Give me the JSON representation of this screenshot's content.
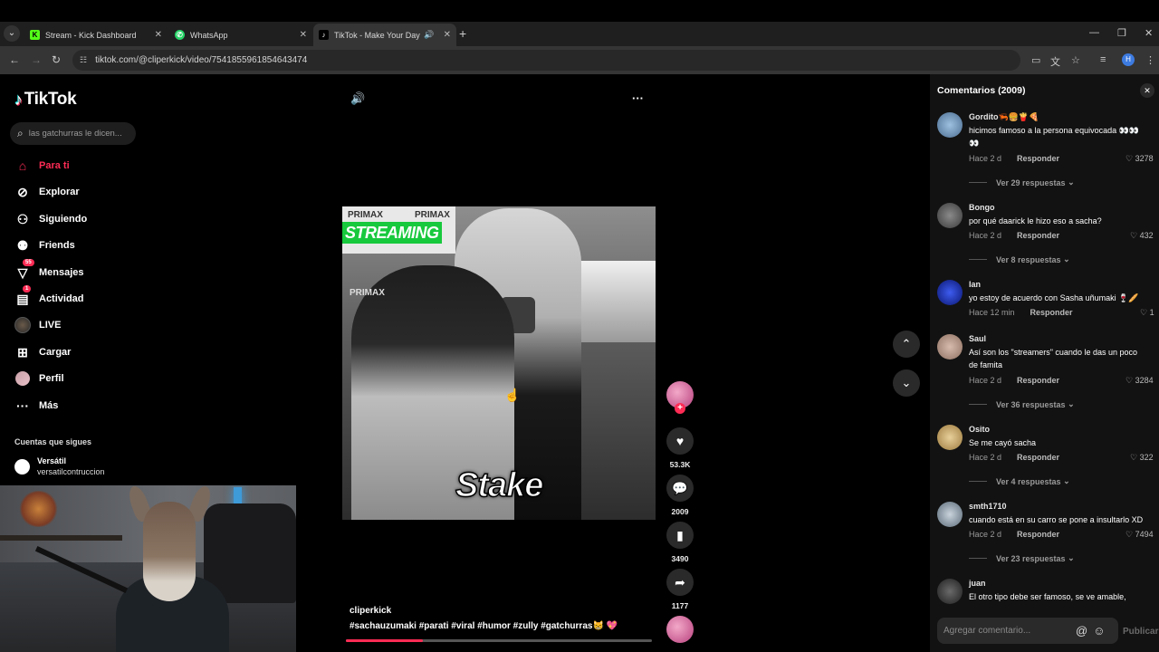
{
  "browser": {
    "tabs": [
      {
        "title": "Stream - Kick Dashboard",
        "favicon_color": "#53fc18",
        "favicon_glyph": "K"
      },
      {
        "title": "WhatsApp",
        "favicon_color": "#25d366",
        "favicon_glyph": "✆"
      },
      {
        "title": "TikTok - Make Your Day",
        "favicon_color": "#000000",
        "favicon_glyph": "♪"
      }
    ],
    "url": "tiktok.com/@cliperkick/video/7541855961854643474",
    "profile_initial": "H"
  },
  "sidebar": {
    "logo": "TikTok",
    "search_placeholder": "las gatchurras le dicen...",
    "nav": [
      {
        "label": "Para ti",
        "icon": "home-icon",
        "active": true
      },
      {
        "label": "Explorar",
        "icon": "compass-icon"
      },
      {
        "label": "Siguiendo",
        "icon": "following-icon"
      },
      {
        "label": "Friends",
        "icon": "friends-icon"
      },
      {
        "label": "Mensajes",
        "icon": "messages-icon",
        "badge": "55"
      },
      {
        "label": "Actividad",
        "icon": "activity-icon",
        "badge": "1"
      },
      {
        "label": "LIVE",
        "icon": "live-icon"
      },
      {
        "label": "Cargar",
        "icon": "upload-icon"
      },
      {
        "label": "Perfil",
        "icon": "profile-icon"
      },
      {
        "label": "Más",
        "icon": "more-icon"
      }
    ],
    "follows_title": "Cuentas que sigues",
    "followed_account": {
      "name": "Versátil",
      "handle": "versatilcontruccion"
    }
  },
  "video": {
    "overlay_text_streaming": "STREAMING",
    "overlay_brand": "PRIMAX",
    "overlay_stake": "Stake",
    "author": "cliperkick",
    "hashtags": "#sachauzumaki #parati #viral #humor #zully #gatchurras😸 💖",
    "progress_fraction": 0.25
  },
  "actions": {
    "likes": "53.3K",
    "comments": "2009",
    "saves": "3490",
    "shares": "1177"
  },
  "comments_panel": {
    "title": "Comentarios (2009)",
    "input_placeholder": "Agregar comentario...",
    "publish_label": "Publicar",
    "reply_label": "Responder",
    "comments": [
      {
        "user": "Gordito🦐🍔🍟🍕",
        "text": "hicimos famoso a la persona equivocada 👀👀👀",
        "time": "Hace 2 d",
        "likes": "3278",
        "replies": "Ver 29 respuestas",
        "avatar_color": "#6a8caf"
      },
      {
        "user": "Bongo",
        "text": "por qué daarick le hizo eso a sacha?",
        "time": "Hace 2 d",
        "likes": "432",
        "replies": "Ver 8 respuestas",
        "avatar_color": "#5a5a5a"
      },
      {
        "user": "Ian",
        "text": "yo estoy de acuerdo con Sasha uñumaki 🍷🥖",
        "time": "Hace 12 min",
        "likes": "1",
        "replies": "",
        "avatar_color": "#1c2fa8"
      },
      {
        "user": "Saul",
        "text": "Así son los \"streamers\" cuando le das un poco de famita",
        "time": "Hace 2 d",
        "likes": "3284",
        "replies": "Ver 36 respuestas",
        "avatar_color": "#b59a8a"
      },
      {
        "user": "Osito",
        "text": "Se me cayó sacha",
        "time": "Hace 2 d",
        "likes": "322",
        "replies": "Ver 4 respuestas",
        "avatar_color": "#c9a56a"
      },
      {
        "user": "smth1710",
        "text": "cuando está en su carro se pone a insultarlo XD",
        "time": "Hace 2 d",
        "likes": "7494",
        "replies": "Ver 23 respuestas",
        "avatar_color": "#8a9aa8"
      },
      {
        "user": "juan",
        "text": "El otro tipo debe ser famoso, se ve amable,",
        "time": "",
        "likes": "",
        "replies": "",
        "avatar_color": "#3a3a3a"
      }
    ]
  }
}
